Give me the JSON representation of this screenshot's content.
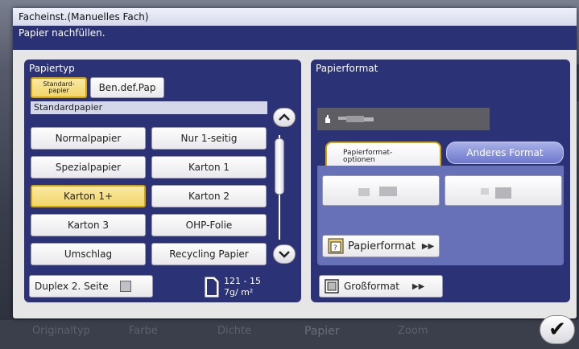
{
  "background": {
    "tabs": [
      {
        "label": "Originaltyp"
      },
      {
        "label": "Farbe"
      },
      {
        "label": "Dichte"
      },
      {
        "label": "Papier"
      },
      {
        "label": "Zoom"
      }
    ]
  },
  "dialog": {
    "title": "Facheinst.(Manuelles Fach)",
    "message": "Papier nachfüllen."
  },
  "papiertyp": {
    "title": "Papiertyp",
    "mode_buttons": [
      {
        "label": "Standard-\npapier",
        "selected": true
      },
      {
        "label": "Ben.def.Pap",
        "selected": false
      }
    ],
    "list_header": "Standardpapier",
    "types": [
      {
        "label": "Normalpapier",
        "selected": false
      },
      {
        "label": "Nur 1-seitig",
        "selected": false
      },
      {
        "label": "Spezialpapier",
        "selected": false
      },
      {
        "label": "Karton 1",
        "selected": false
      },
      {
        "label": "Karton 1+",
        "selected": true
      },
      {
        "label": "Karton 2",
        "selected": false
      },
      {
        "label": "Karton 3",
        "selected": false
      },
      {
        "label": "OHP-Folie",
        "selected": false
      },
      {
        "label": "Umschlag",
        "selected": false
      },
      {
        "label": "Recycling Papier",
        "selected": false
      }
    ],
    "duplex_label": "Duplex 2. Seite",
    "weight_line1": "121 - 15",
    "weight_line2": "7g/ m²"
  },
  "papierformat": {
    "title": "Papierformat",
    "tab_options": "Papierformat-\noptionen",
    "tab_other": "Anderes Format",
    "format_button": "Papierformat",
    "grossformat_button": "Großformat"
  },
  "colors": {
    "panel": "#2b3276",
    "message_bar": "#2a3175",
    "selected": "#f2d66a",
    "selected_border": "#d7a500"
  }
}
